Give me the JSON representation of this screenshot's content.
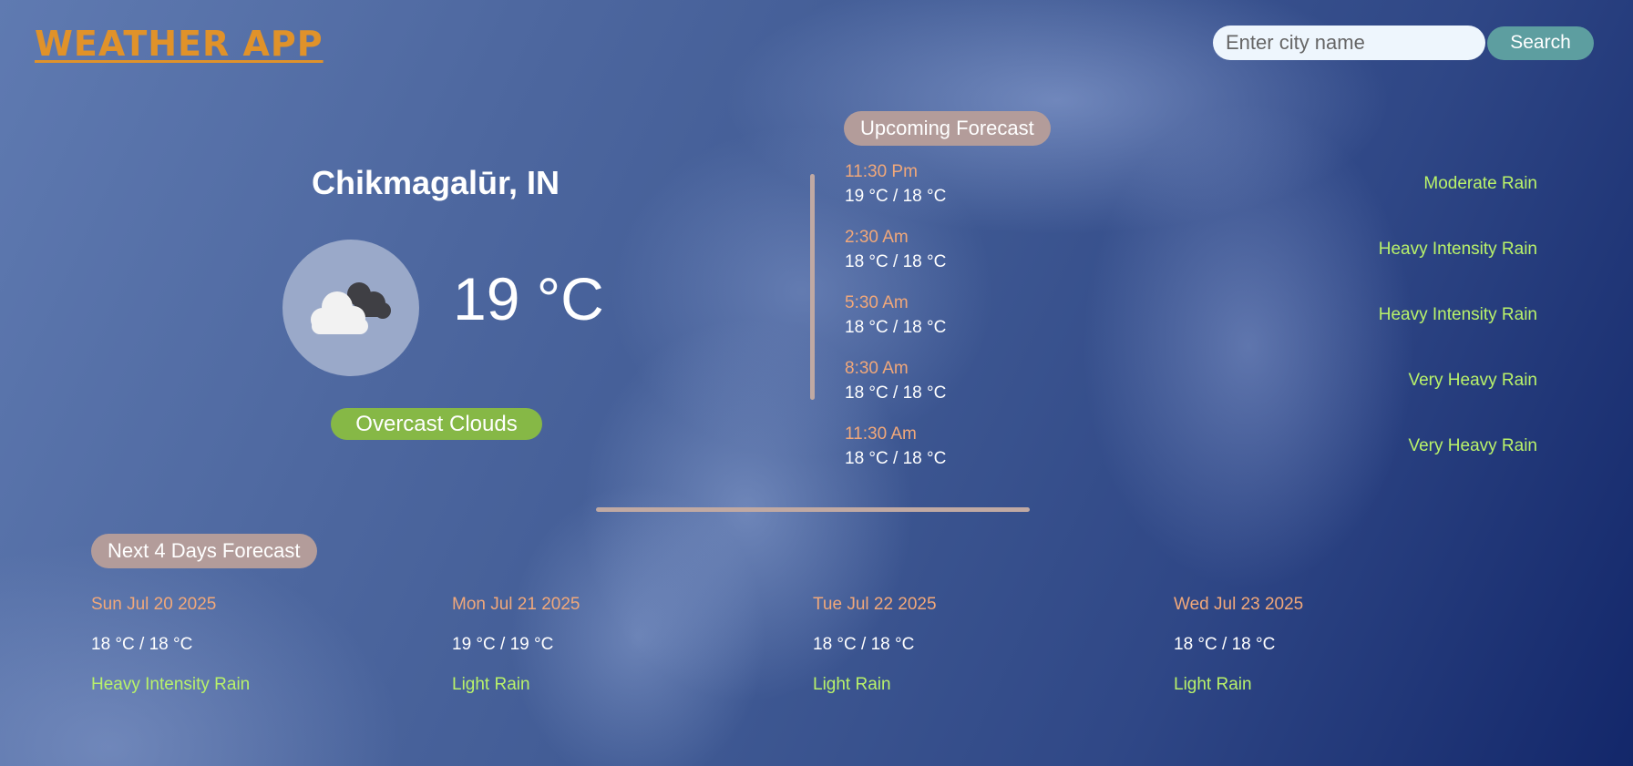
{
  "header": {
    "logo": "WEATHER APP"
  },
  "search": {
    "placeholder": "Enter city name",
    "value": "",
    "button_label": "Search"
  },
  "current": {
    "city": "Chikmagalūr, IN",
    "temperature": "19 °C",
    "description": "Overcast Clouds",
    "icon": "overcast-clouds-icon"
  },
  "upcoming": {
    "title": "Upcoming Forecast",
    "items": [
      {
        "time": "11:30 Pm",
        "range": "19 °C / 18 °C",
        "condition": "Moderate Rain"
      },
      {
        "time": "2:30 Am",
        "range": "18 °C / 18 °C",
        "condition": "Heavy Intensity Rain"
      },
      {
        "time": "5:30 Am",
        "range": "18 °C / 18 °C",
        "condition": "Heavy Intensity Rain"
      },
      {
        "time": "8:30 Am",
        "range": "18 °C / 18 °C",
        "condition": "Very Heavy Rain"
      },
      {
        "time": "11:30 Am",
        "range": "18 °C / 18 °C",
        "condition": "Very Heavy Rain"
      }
    ]
  },
  "daily": {
    "title": "Next 4 Days Forecast",
    "days": [
      {
        "date": "Sun Jul 20 2025",
        "range": "18 °C / 18 °C",
        "condition": "Heavy Intensity Rain"
      },
      {
        "date": "Mon Jul 21 2025",
        "range": "19 °C / 19 °C",
        "condition": "Light Rain"
      },
      {
        "date": "Tue Jul 22 2025",
        "range": "18 °C / 18 °C",
        "condition": "Light Rain"
      },
      {
        "date": "Wed Jul 23 2025",
        "range": "18 °C / 18 °C",
        "condition": "Light Rain"
      }
    ]
  },
  "colors": {
    "logo": "#e0922a",
    "search_button": "#5d9ea0",
    "description_pill": "#86b846",
    "section_pill": "#b39c9a",
    "time_text": "#f1a87a",
    "condition_text": "#b9f26a",
    "divider": "#c0a9a3"
  }
}
